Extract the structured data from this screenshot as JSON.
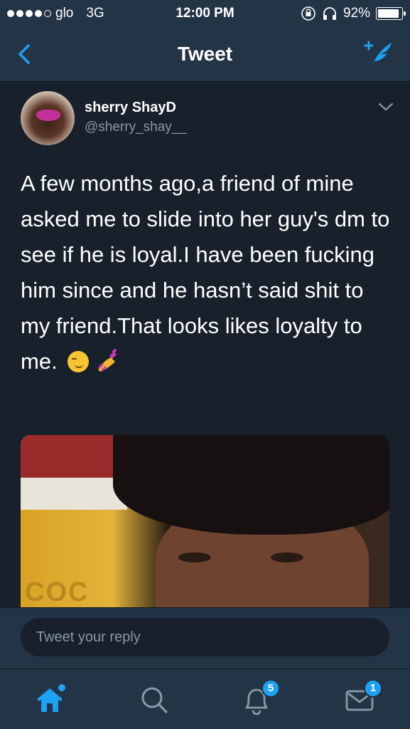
{
  "status_bar": {
    "carrier": "glo",
    "network": "3G",
    "time": "12:00 PM",
    "battery": "92%",
    "battery_level": 0.92
  },
  "nav": {
    "title": "Tweet",
    "back_icon": "chevron-left-icon",
    "compose_icon": "compose-tweet-icon"
  },
  "tweet": {
    "author_name": "sherry ShayD",
    "author_handle": "@sherry_shay__",
    "text": "A few months ago,a friend of mine asked me to slide into her guy's dm to see if he is loyal.I have been fucking him since and he hasn’t said shit  to my friend.That looks likes loyalty to me.",
    "emojis": [
      "smirking-face",
      "nail-polish"
    ]
  },
  "media": {
    "logo_text": "COC"
  },
  "reply": {
    "placeholder": "Tweet your reply"
  },
  "tabs": {
    "home_icon": "home-icon",
    "search_icon": "search-icon",
    "notifications_icon": "bell-icon",
    "notifications_badge": "5",
    "messages_icon": "envelope-icon",
    "messages_badge": "1"
  },
  "colors": {
    "background": "#17202b",
    "bar": "#243447",
    "accent": "#1da1f2",
    "secondary_text": "#8899a6"
  }
}
